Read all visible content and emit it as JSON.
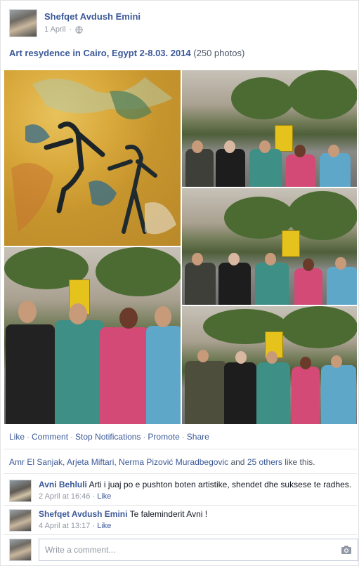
{
  "post": {
    "author": "Shefqet Avdush Emini",
    "date": "1 April",
    "album_name": "Art resydence in Cairo, Egypt 2-8.03. 2014",
    "album_count": "(250 photos)"
  },
  "actions": {
    "like": "Like",
    "comment": "Comment",
    "stop_notifications": "Stop Notifications",
    "promote": "Promote",
    "share": "Share",
    "separator": "·"
  },
  "likes": {
    "names": "Amr El Sanjak, Arjeta Miftari, Nerma Pizović Muradbegovic",
    "and": "and",
    "others": "25 others",
    "suffix": "like this."
  },
  "comments": [
    {
      "author": "Avni Behluli",
      "text": "Arti i juaj po e pushton boten artistike, shendet dhe suksese te radhes.",
      "time": "2 April at 16:46",
      "like": "Like"
    },
    {
      "author": "Shefqet Avdush Emini",
      "text": "Te faleminderit Avni !",
      "time": "4 April at 13:17",
      "like": "Like"
    }
  ],
  "composer": {
    "placeholder": "Write a comment..."
  },
  "colors": {
    "link": "#3b5998",
    "muted": "#9197a3",
    "painting_yellow": "#d9a93c",
    "stand_yellow": "#e6c21d"
  }
}
